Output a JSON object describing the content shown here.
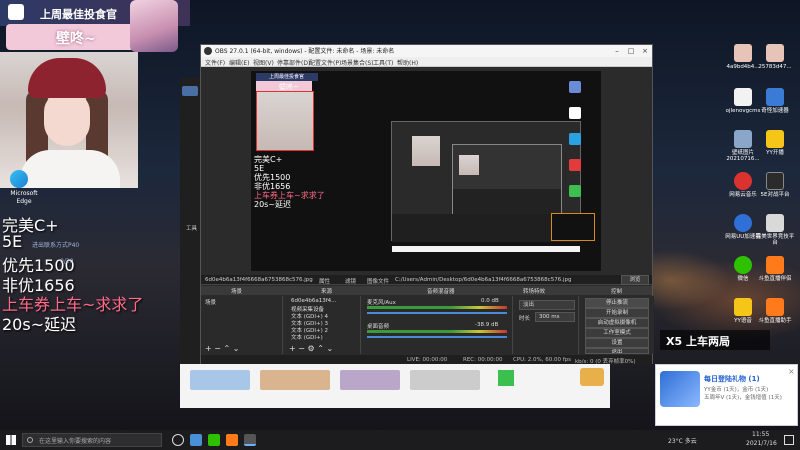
{
  "overlay": {
    "banner_title": "上周最佳投食官",
    "streamer_name": "壁咚~",
    "lines": [
      "完美C+",
      "5E",
      "优先1500",
      "非优1656",
      "上车券上车~求求了",
      "20s~延迟"
    ],
    "small_tags": [
      "进出联系方式P40",
      "0/20"
    ]
  },
  "desktop": {
    "left_icon_label": "Microsoft Edge",
    "right_icons": [
      {
        "label": "4a9bd4b4..."
      },
      {
        "label": "25783d47..."
      },
      {
        "label": "ojlenovgcms"
      },
      {
        "label": "奇怪加速器"
      },
      {
        "label": "壁纸图片 20210716..."
      },
      {
        "label": "YY开播"
      },
      {
        "label": "网易云音乐"
      },
      {
        "label": "5E对战平台"
      },
      {
        "label": "网易UU加速器"
      },
      {
        "label": "完美世界竞技平台"
      },
      {
        "label": "微信"
      },
      {
        "label": "斗鱼直播伴侣"
      },
      {
        "label": "YY语音"
      },
      {
        "label": "斗鱼直播助手"
      },
      {
        "label": "X5 上车两局"
      }
    ]
  },
  "obs": {
    "title": "OBS 27.0.1 (64-bit, windows) - 配置文件: 未命名 - 场景: 未命名",
    "menu": [
      "文件(F)",
      "编辑(E)",
      "视图(V)",
      "停靠部件(D)",
      "配置文件(P)",
      "场景集合(S)",
      "工具(T)",
      "帮助(H)"
    ],
    "file_path": "6d0e4b6a13f4f6668a6753868c576.jpg",
    "properties_label": "属性",
    "filters_label": "滤镜",
    "image_file_label": "图像文件",
    "image_file_path": "C:/Users/Admin/Desktop/6d0e4b6a13f4f6668a6753868c576.jpg",
    "browse": "浏览",
    "panels": {
      "scenes": "场景",
      "sources": "来源",
      "mixer": "音频混音器",
      "transitions": "转场特效",
      "controls": "控制"
    },
    "scene_item": "场景",
    "sources": [
      "6d0e4b6a13f4...",
      "视频采集设备",
      "文本 (GDI+) 4",
      "文本 (GDI+) 3",
      "文本 (GDI+) 2",
      "文本 (GDI+)"
    ],
    "mixer": {
      "ch1": "麦克风/Aux",
      "ch1_db": "0.0 dB",
      "ch2": "桌面音频",
      "ch2_db": "-38.9 dB"
    },
    "transition_type": "淡出",
    "duration_label": "时长",
    "duration_value": "300 ms",
    "controls": [
      "停止推流",
      "开始录制",
      "启动虚拟摄像机",
      "工作室模式",
      "设置",
      "退出"
    ],
    "status": {
      "live": "LIVE: 00:00:00",
      "rec": "REC: 00:00:00",
      "cpu": "CPU: 2.0%, 60.00 fps",
      "kb": "kb/s: 0 (0 丢弃帧率0%)"
    }
  },
  "notification": {
    "title": "每日登陆礼物 (1)",
    "line1": "YY金币 (1天)，金币 (1天)",
    "line2": "五周年V (1天)，金钱增值 (1天)"
  },
  "taskbar": {
    "search_placeholder": "在这里输入你要搜索的内容",
    "weather": "23°C 多云",
    "time": "11:55",
    "date": "2021/7/16"
  },
  "colors": {
    "accent_red": "#ff6b8a",
    "banner": "#2e3a66",
    "obs_bg": "#2b2b2b"
  }
}
